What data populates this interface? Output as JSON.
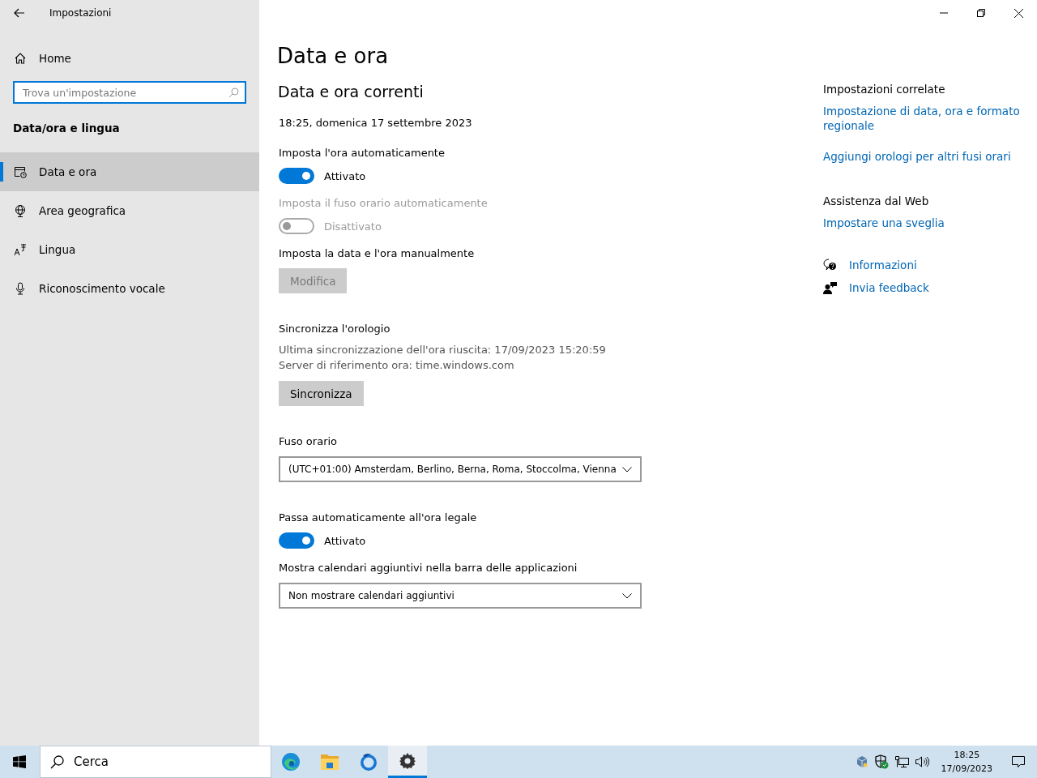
{
  "window": {
    "title": "Impostazioni"
  },
  "sidebar": {
    "home": "Home",
    "search": {
      "placeholder": "Trova un'impostazione"
    },
    "section": "Data/ora e lingua",
    "items": [
      {
        "label": "Data e ora",
        "kind": "calendar",
        "selected": true
      },
      {
        "label": "Area geografica",
        "kind": "globe",
        "selected": false
      },
      {
        "label": "Lingua",
        "kind": "language",
        "selected": false
      },
      {
        "label": "Riconoscimento vocale",
        "kind": "mic",
        "selected": false
      }
    ]
  },
  "main": {
    "title": "Data e ora",
    "subtitle": "Data e ora correnti",
    "current": "18:25, domenica 17 settembre 2023",
    "settings": [
      {
        "kind": "toggle",
        "label": "Imposta l'ora automaticamente",
        "on": true,
        "state": "Attivato",
        "disabled": false
      },
      {
        "kind": "toggle",
        "label": "Imposta il fuso orario automaticamente",
        "on": false,
        "state": "Disattivato",
        "disabled": true
      },
      {
        "kind": "button",
        "label": "Imposta la data e l'ora manualmente",
        "button": "Modifica",
        "disabled": true
      },
      {
        "kind": "button",
        "label": "Sincronizza l'orologio",
        "lines": [
          "Ultima sincronizzazione dell'ora riuscita: 17/09/2023 15:20:59",
          "Server di riferimento ora: time.windows.com"
        ],
        "button": "Sincronizza",
        "disabled": false
      },
      {
        "kind": "dropdown",
        "label": "Fuso orario",
        "value": "(UTC+01:00) Amsterdam, Berlino, Berna, Roma, Stoccolma, Vienna"
      },
      {
        "kind": "toggle",
        "label": "Passa automaticamente all'ora legale",
        "on": true,
        "state": "Attivato",
        "disabled": false
      },
      {
        "kind": "dropdown",
        "label": "Mostra calendari aggiuntivi nella barra delle applicazioni",
        "value": "Non mostrare calendari aggiuntivi"
      }
    ]
  },
  "related": {
    "heading": "Impostazioni correlate",
    "links": [
      "Impostazione di data, ora e formato regionale",
      "Aggiungi orologi per altri fusi orari"
    ],
    "web_heading": "Assistenza dal Web",
    "web_links": [
      "Impostare una sveglia"
    ],
    "help": [
      {
        "label": "Informazioni",
        "kind": "help"
      },
      {
        "label": "Invia feedback",
        "kind": "feedback"
      }
    ]
  },
  "taskbar": {
    "search": "Cerca",
    "apps": [
      {
        "kind": "edge",
        "selected": false
      },
      {
        "kind": "folder",
        "selected": false
      },
      {
        "kind": "mail",
        "selected": false
      },
      {
        "kind": "gear",
        "selected": true
      }
    ],
    "time": "18:25",
    "date": "17/09/2023"
  }
}
